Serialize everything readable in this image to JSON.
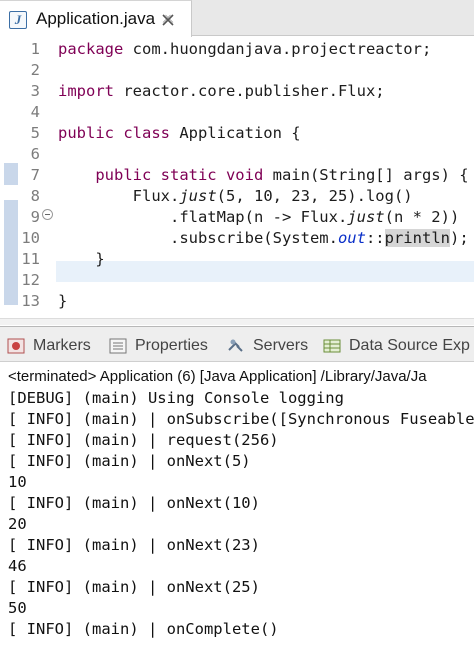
{
  "editor": {
    "tab_label": "Application.java",
    "file_icon_letter": "J",
    "lines": [
      {
        "n": "1",
        "segments": [
          {
            "t": "package",
            "c": "kw"
          },
          {
            "t": " com.huongdanjava.projectreactor;",
            "c": ""
          }
        ]
      },
      {
        "n": "2",
        "segments": []
      },
      {
        "n": "3",
        "segments": [
          {
            "t": "import",
            "c": "kw"
          },
          {
            "t": " reactor.core.publisher.Flux;",
            "c": ""
          }
        ]
      },
      {
        "n": "4",
        "segments": []
      },
      {
        "n": "5",
        "segments": [
          {
            "t": "public class",
            "c": "kw"
          },
          {
            "t": " Application {",
            "c": ""
          }
        ]
      },
      {
        "n": "6",
        "segments": []
      },
      {
        "n": "7",
        "segments": [
          {
            "t": "    ",
            "c": ""
          },
          {
            "t": "public static void",
            "c": "kw"
          },
          {
            "t": " main(String[] args) {",
            "c": ""
          }
        ]
      },
      {
        "n": "8",
        "segments": [
          {
            "t": "        Flux.",
            "c": ""
          },
          {
            "t": "just",
            "c": "it"
          },
          {
            "t": "(5, 10, 23, 25).log()",
            "c": ""
          }
        ]
      },
      {
        "n": "9",
        "segments": [
          {
            "t": "            .flatMap(n -> Flux.",
            "c": ""
          },
          {
            "t": "just",
            "c": "it"
          },
          {
            "t": "(n * 2))",
            "c": ""
          }
        ]
      },
      {
        "n": "10",
        "segments": [
          {
            "t": "            .subscribe(System.",
            "c": ""
          },
          {
            "t": "out",
            "c": "fld"
          },
          {
            "t": "::",
            "c": ""
          },
          {
            "t": "print",
            "c": "sel"
          },
          {
            "t": "",
            "c": "caret"
          },
          {
            "t": "ln",
            "c": "sel"
          },
          {
            "t": ");",
            "c": ""
          }
        ]
      },
      {
        "n": "11",
        "segments": [
          {
            "t": "    }",
            "c": ""
          }
        ]
      },
      {
        "n": "12",
        "segments": []
      },
      {
        "n": "13",
        "segments": [
          {
            "t": "}",
            "c": ""
          }
        ]
      }
    ]
  },
  "panel": {
    "tabs": [
      {
        "label": "Markers",
        "icon": "markers-icon"
      },
      {
        "label": "Properties",
        "icon": "properties-icon"
      },
      {
        "label": "Servers",
        "icon": "servers-icon"
      },
      {
        "label": "Data Source Exp",
        "icon": "data-source-icon"
      }
    ],
    "console_title": "<terminated> Application (6) [Java Application] /Library/Java/Ja",
    "console_lines": [
      "[DEBUG] (main) Using Console logging",
      "[ INFO] (main) | onSubscribe([Synchronous Fuseable",
      "[ INFO] (main) | request(256)",
      "[ INFO] (main) | onNext(5)",
      "10",
      "[ INFO] (main) | onNext(10)",
      "20",
      "[ INFO] (main) | onNext(23)",
      "46",
      "[ INFO] (main) | onNext(25)",
      "50",
      "[ INFO] (main) | onComplete()"
    ]
  },
  "colors": {
    "keyword": "#7f0055",
    "static_field": "#0a2fc8",
    "line_highlight": "#e8f1fa",
    "line_number": "#7c7c7c"
  }
}
